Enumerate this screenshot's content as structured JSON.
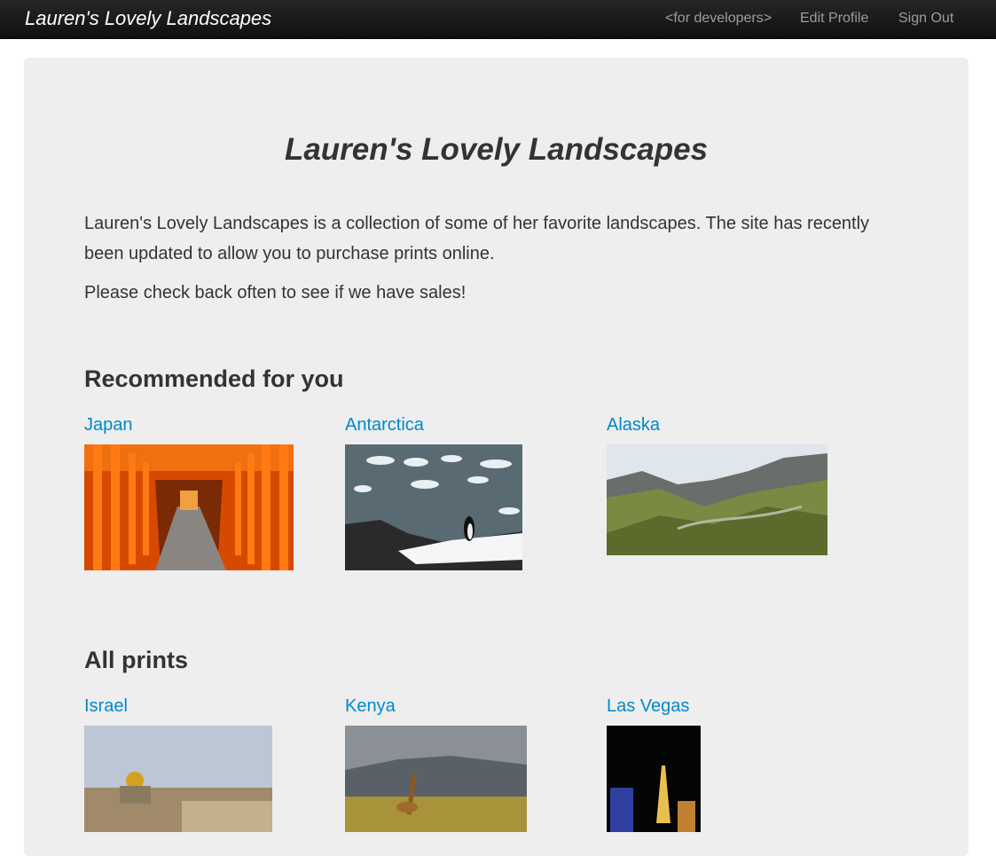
{
  "navbar": {
    "brand": "Lauren's Lovely Landscapes",
    "links": [
      "<for developers>",
      "Edit Profile",
      "Sign Out"
    ]
  },
  "hero": {
    "title": "Lauren's Lovely Landscapes",
    "intro": "Lauren's Lovely Landscapes is a collection of some of her favorite landscapes. The site has recently been updated to allow you to purchase prints online.",
    "intro2": "Please check back often to see if we have sales!"
  },
  "recommended": {
    "title": "Recommended for you",
    "items": [
      "Japan",
      "Antarctica",
      "Alaska"
    ]
  },
  "all_prints": {
    "title": "All prints",
    "items": [
      "Israel",
      "Kenya",
      "Las Vegas"
    ]
  }
}
